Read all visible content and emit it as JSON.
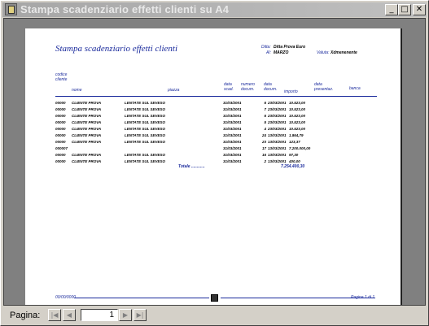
{
  "window": {
    "title": "Stampa scadenziario effetti clienti su A4",
    "minimize": "_",
    "maximize": "□",
    "close": "✕"
  },
  "report": {
    "title": "Stampa scadenziario effetti clienti",
    "ditta_label": "Ditta:",
    "ditta_value": "Ditta Prova Euro",
    "al_label": "Al:",
    "al_value": "MARZO",
    "valuta_label": "Valuta:",
    "valuta_value": "Xdmenenente",
    "headers": {
      "codice_cliente": "codice cliente",
      "nome": "nome",
      "piazza": "piazza",
      "data_scad": "data scad.",
      "numero_docum": "numero docum.",
      "data_docum": "data docum.",
      "importo": "importo",
      "data_presentaz": "data presentaz.",
      "banca": "banca"
    },
    "rows": [
      {
        "code": "00000",
        "name": "CLIENTE PROVA",
        "place": "LENTATE SUL SEVESO",
        "scad": "31/03/2001",
        "num": "6",
        "doc": "23/03/2001",
        "amount": "10.523,00"
      },
      {
        "code": "00000",
        "name": "CLIENTE PROVA",
        "place": "LENTATE SUL SEVESO",
        "scad": "31/03/2001",
        "num": "7",
        "doc": "23/03/2001",
        "amount": "10.523,00"
      },
      {
        "code": "00000",
        "name": "CLIENTE PROVA",
        "place": "LENTATE SUL SEVESO",
        "scad": "31/03/2001",
        "num": "6",
        "doc": "23/03/2001",
        "amount": "10.523,00"
      },
      {
        "code": "00000",
        "name": "CLIENTE PROVA",
        "place": "LENTATE SUL SEVESO",
        "scad": "31/03/2001",
        "num": "5",
        "doc": "23/03/2001",
        "amount": "10.523,00"
      },
      {
        "code": "00000",
        "name": "CLIENTE PROVA",
        "place": "LENTATE SUL SEVESO",
        "scad": "31/03/2001",
        "num": "4",
        "doc": "23/03/2001",
        "amount": "10.523,00"
      },
      {
        "code": "00000",
        "name": "CLIENTE PROVA",
        "place": "LENTATE SUL SEVESO",
        "scad": "31/03/2001",
        "num": "24",
        "doc": "13/03/2001",
        "amount": "1.864,79"
      },
      {
        "code": "00000",
        "name": "CLIENTE PROVA",
        "place": "LENTATE SUL SEVESO",
        "scad": "31/03/2001",
        "num": "23",
        "doc": "13/03/2001",
        "amount": "123,37"
      },
      {
        "code": "000007",
        "name": "",
        "place": "",
        "scad": "31/03/2001",
        "num": "17",
        "doc": "13/03/2001",
        "amount": "7.200.000,00"
      },
      {
        "code": "00000",
        "name": "CLIENTE PROVA",
        "place": "LENTATE SUL SEVESO",
        "scad": "31/03/2001",
        "num": "16",
        "doc": "13/03/2001",
        "amount": "97,30"
      },
      {
        "code": "00000",
        "name": "CLIENTE PROVA",
        "place": "LENTATE SUL SEVESO",
        "scad": "31/03/2001",
        "num": "2",
        "doc": "13/03/2001",
        "amount": "400,00"
      }
    ],
    "total_label": "Totale ............",
    "total_value": "7.254.400,30",
    "footer_left": "00/00/0000",
    "footer_right": "Pagina 1 di 1"
  },
  "status": {
    "page_label": "Pagina:",
    "page_value": "1",
    "first": "|◀",
    "prev": "◀",
    "next": "▶",
    "last": "▶|"
  }
}
